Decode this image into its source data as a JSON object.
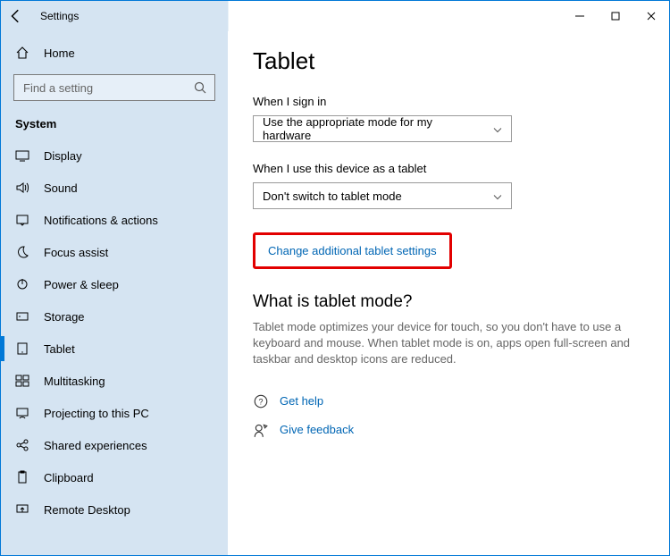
{
  "window": {
    "title": "Settings"
  },
  "sidebar": {
    "home": "Home",
    "search_placeholder": "Find a setting",
    "section": "System",
    "items": [
      {
        "label": "Display"
      },
      {
        "label": "Sound"
      },
      {
        "label": "Notifications & actions"
      },
      {
        "label": "Focus assist"
      },
      {
        "label": "Power & sleep"
      },
      {
        "label": "Storage"
      },
      {
        "label": "Tablet"
      },
      {
        "label": "Multitasking"
      },
      {
        "label": "Projecting to this PC"
      },
      {
        "label": "Shared experiences"
      },
      {
        "label": "Clipboard"
      },
      {
        "label": "Remote Desktop"
      }
    ]
  },
  "content": {
    "heading": "Tablet",
    "signin_label": "When I sign in",
    "signin_value": "Use the appropriate mode for my hardware",
    "astablet_label": "When I use this device as a tablet",
    "astablet_value": "Don't switch to tablet mode",
    "change_link": "Change additional tablet settings",
    "info_heading": "What is tablet mode?",
    "info_body": "Tablet mode optimizes your device for touch, so you don't have to use a keyboard and mouse. When tablet mode is on, apps open full-screen and taskbar and desktop icons are reduced.",
    "help_link": "Get help",
    "feedback_link": "Give feedback"
  }
}
